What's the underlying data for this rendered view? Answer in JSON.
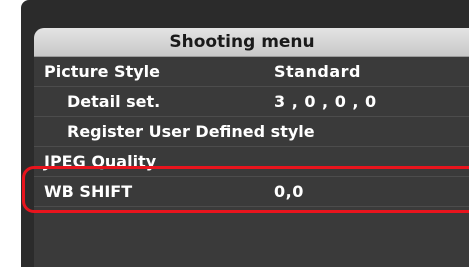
{
  "menu": {
    "title": "Shooting menu",
    "items": [
      {
        "label": "Picture Style",
        "value": "Standard"
      },
      {
        "label": "Detail set.",
        "value": "3 , 0 , 0 , 0"
      },
      {
        "label": "Register User Defined style",
        "value": ""
      },
      {
        "label": "JPEG Quality",
        "value": ""
      },
      {
        "label": "WB SHIFT",
        "value": "0,0"
      }
    ]
  },
  "colors": {
    "highlight": "#e8141d",
    "panel_bg": "#3a3a3a",
    "header_bg": "#d6d6d6"
  }
}
